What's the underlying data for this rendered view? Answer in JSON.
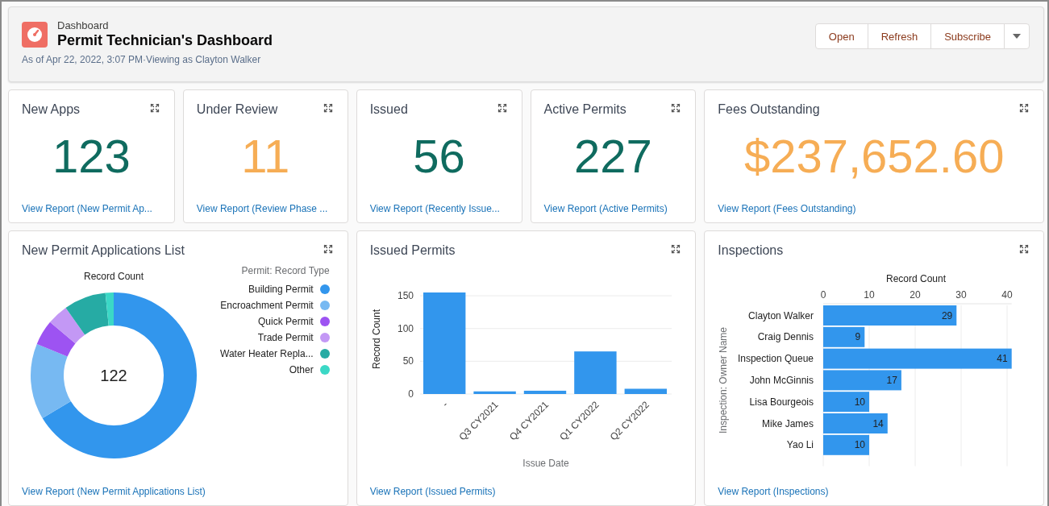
{
  "header": {
    "kicker": "Dashboard",
    "title": "Permit Technician's Dashboard",
    "subtitle": "As of Apr 22, 2022, 3:07 PM·Viewing as Clayton Walker",
    "buttons": [
      "Open",
      "Refresh",
      "Subscribe"
    ]
  },
  "metrics": [
    {
      "title": "New Apps",
      "value": "123",
      "color": "#0f6b5f",
      "link": "View Report (New Permit Ap..."
    },
    {
      "title": "Under Review",
      "value": "11",
      "color": "#f6ad55",
      "link": "View Report (Review Phase ..."
    },
    {
      "title": "Issued",
      "value": "56",
      "color": "#0f6b5f",
      "link": "View Report (Recently Issue..."
    },
    {
      "title": "Active Permits",
      "value": "227",
      "color": "#0f6b5f",
      "link": "View Report (Active Permits)"
    },
    {
      "title": "Fees Outstanding",
      "value": "$237,652.60",
      "color": "#f6ad55",
      "link": "View Report (Fees Outstanding)"
    }
  ],
  "applications": {
    "title": "New Permit Applications List",
    "chart_title": "Record Count",
    "total": "122",
    "legend_title": "Permit: Record Type",
    "legend": [
      {
        "label": "Building Permit",
        "color": "#3296ed"
      },
      {
        "label": "Encroachment Permit",
        "color": "#77b9f2"
      },
      {
        "label": "Quick Permit",
        "color": "#9d53f2"
      },
      {
        "label": "Trade Permit",
        "color": "#c398f5"
      },
      {
        "label": "Water Heater Repla...",
        "color": "#26aba4"
      },
      {
        "label": "Other",
        "color": "#3bd8c6"
      }
    ],
    "link": "View Report (New Permit Applications List)"
  },
  "issued": {
    "title": "Issued Permits",
    "link": "View Report (Issued Permits)",
    "chart_data": {
      "type": "bar",
      "xlabel": "Issue Date",
      "grid": true,
      "categories": [
        "-",
        "Q3 CY2021",
        "Q4 CY2021",
        "Q1 CY2022",
        "Q2 CY2022"
      ],
      "series": [
        {
          "name": "Record Count",
          "color": "#3296ed",
          "values": [
            155,
            4,
            5,
            65,
            8
          ]
        }
      ],
      "ylim": [
        0,
        155
      ],
      "yticks": [
        0,
        50,
        100,
        150
      ]
    }
  },
  "inspections": {
    "title": "Inspections",
    "link": "View Report (Inspections)",
    "chart_data": {
      "type": "bar",
      "orientation": "horizontal",
      "ylabel": "Inspection: Owner Name",
      "grid": true,
      "categories": [
        "Clayton Walker",
        "Craig Dennis",
        "Inspection Queue",
        "John McGinnis",
        "Lisa Bourgeois",
        "Mike James",
        "Yao Li"
      ],
      "series": [
        {
          "name": "Record Count",
          "color": "#3296ed",
          "values": [
            29,
            9,
            41,
            17,
            10,
            14,
            10
          ]
        }
      ],
      "xlim": [
        0,
        41
      ],
      "xticks": [
        0,
        10,
        20,
        30,
        40
      ],
      "data_labels": true
    }
  }
}
